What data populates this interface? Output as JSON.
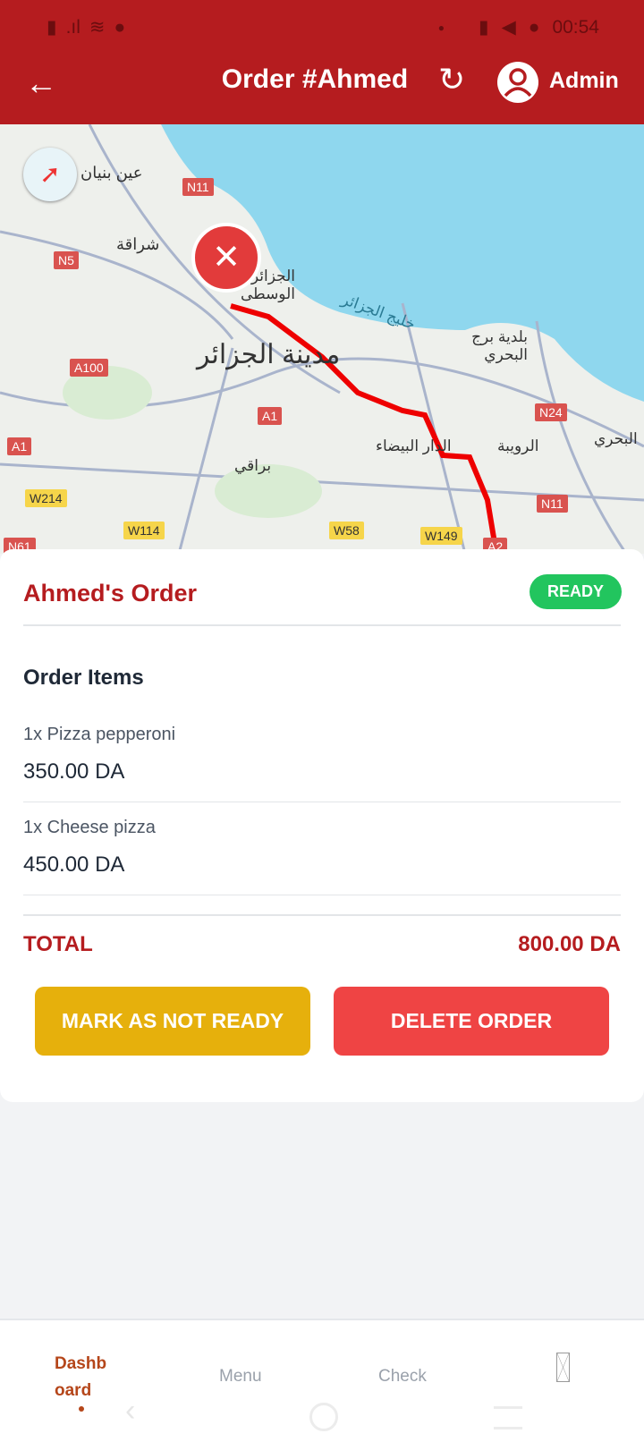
{
  "status_bar": {
    "time": "00:54"
  },
  "header": {
    "title": "Order #Ahmed",
    "user": "Admin"
  },
  "map": {
    "labels": [
      {
        "t": "عين بنيان"
      },
      {
        "t": "شراقة"
      },
      {
        "t": "الجزائر الوسطى"
      },
      {
        "t": "خليج الجزائر"
      },
      {
        "t": "مدينة الجزائر"
      },
      {
        "t": "بلدية برج البحري"
      },
      {
        "t": "الدار البيضاء"
      },
      {
        "t": "الرويبة"
      },
      {
        "t": "براقي"
      },
      {
        "t": "البحري"
      }
    ],
    "roads": [
      "N11",
      "N5",
      "A100",
      "A1",
      "A1",
      "N24",
      "N11",
      "W214",
      "W114",
      "W58",
      "W149",
      "A2",
      "N61"
    ]
  },
  "order": {
    "name": "Ahmed's Order",
    "status": "READY",
    "status_color": "#22c55e",
    "section_title": "Order Items",
    "items": [
      {
        "name": "1x Pizza pepperoni",
        "price": "350.00 DA"
      },
      {
        "name": "1x Cheese pizza",
        "price": "450.00 DA"
      }
    ],
    "total_label": "TOTAL",
    "total_value": "800.00 DA",
    "mark_button": "MARK AS NOT READY",
    "delete_button": "DELETE ORDER"
  },
  "nav": {
    "items": [
      {
        "label": "Dashboard"
      },
      {
        "label": "Menu"
      },
      {
        "label": "Check"
      }
    ]
  },
  "colors": {
    "brand": "#b51c1f",
    "mark": "#e6b00c",
    "delete": "#ef4444"
  }
}
